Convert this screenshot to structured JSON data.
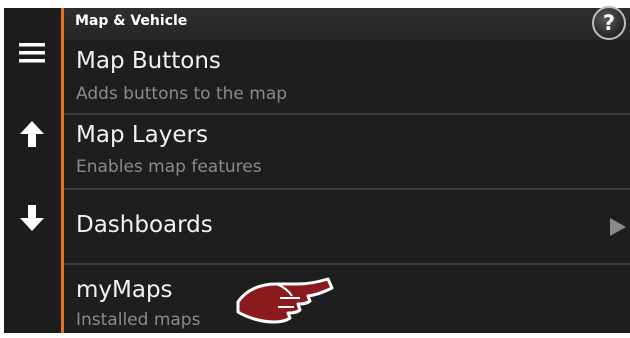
{
  "header": {
    "title": "Map & Vehicle",
    "help_label": "?"
  },
  "nav": {
    "menu_icon": "hamburger-menu-icon",
    "up_icon": "arrow-up-icon",
    "down_icon": "arrow-down-icon"
  },
  "menu": {
    "items": [
      {
        "title": "Map Buttons",
        "subtitle": "Adds buttons to the map"
      },
      {
        "title": "Map Layers",
        "subtitle": "Enables map features"
      },
      {
        "title": "Dashboards",
        "subtitle": "",
        "has_submenu": true,
        "submenu_icon": "chevron-right-icon"
      },
      {
        "title": "myMaps",
        "subtitle": "Installed maps"
      }
    ]
  },
  "overlay": {
    "pointer_icon": "pointing-hand-icon"
  },
  "colors": {
    "accent": "#e8731a",
    "background": "#1e1e1e",
    "title_text": "#f2f2f2",
    "subtitle_text": "#8a8a8a",
    "pointer": "#8b1a1f"
  }
}
